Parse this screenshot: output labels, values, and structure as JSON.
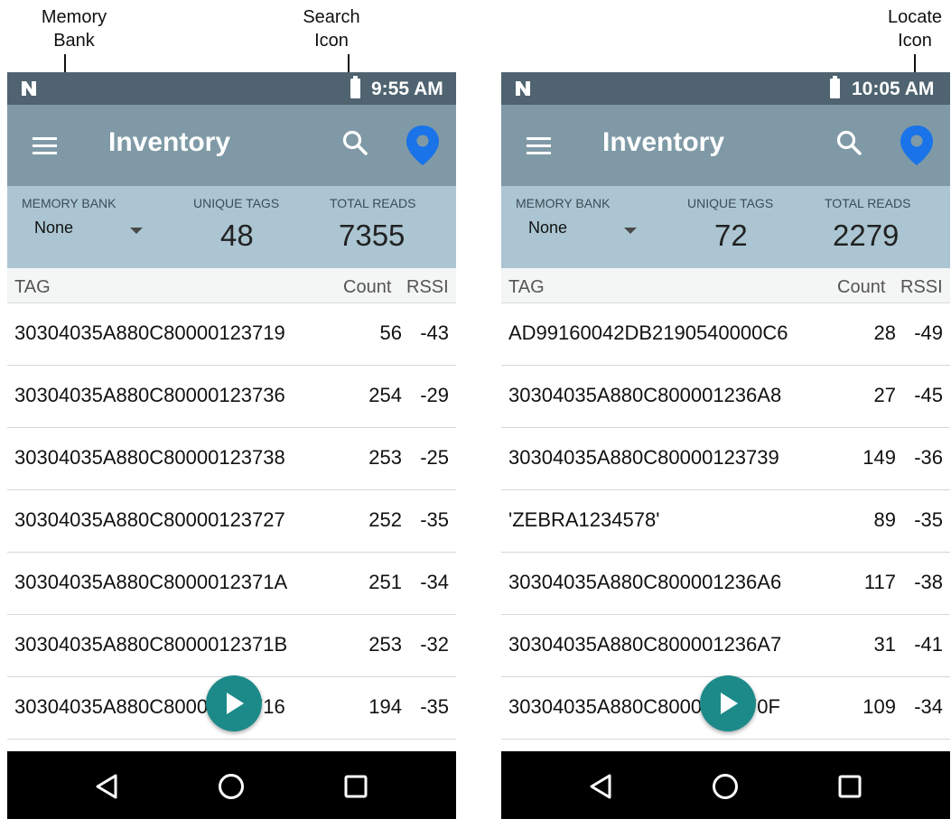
{
  "callouts": {
    "memory_bank": "Memory\nBank",
    "search_icon": "Search\nIcon",
    "locate_icon": "Locate\nIcon"
  },
  "screens": [
    {
      "status_time": "9:55 AM",
      "title": "Inventory",
      "stats": {
        "memory_bank_label": "MEMORY BANK",
        "memory_bank_value": "None",
        "unique_tags_label": "UNIQUE TAGS",
        "unique_tags_value": "48",
        "total_reads_label": "TOTAL READS",
        "total_reads_value": "7355"
      },
      "columns": {
        "tag": "TAG",
        "count": "Count",
        "rssi": "RSSI"
      },
      "rows": [
        {
          "tag": "30304035A880C80000123719",
          "count": "56",
          "rssi": "-43"
        },
        {
          "tag": "30304035A880C80000123736",
          "count": "254",
          "rssi": "-29"
        },
        {
          "tag": "30304035A880C80000123738",
          "count": "253",
          "rssi": "-25"
        },
        {
          "tag": "30304035A880C80000123727",
          "count": "252",
          "rssi": "-35"
        },
        {
          "tag": "30304035A880C8000012371A",
          "count": "251",
          "rssi": "-34"
        },
        {
          "tag": "30304035A880C8000012371B",
          "count": "253",
          "rssi": "-32"
        },
        {
          "tag": "30304035A880C80000123716",
          "count": "194",
          "rssi": "-35"
        }
      ]
    },
    {
      "status_time": "10:05 AM",
      "title": "Inventory",
      "stats": {
        "memory_bank_label": "MEMORY BANK",
        "memory_bank_value": "None",
        "unique_tags_label": "UNIQUE TAGS",
        "unique_tags_value": "72",
        "total_reads_label": "TOTAL READS",
        "total_reads_value": "2279"
      },
      "columns": {
        "tag": "TAG",
        "count": "Count",
        "rssi": "RSSI"
      },
      "rows": [
        {
          "tag": "AD99160042DB2190540000C6",
          "count": "28",
          "rssi": "-49"
        },
        {
          "tag": "30304035A880C800001236A8",
          "count": "27",
          "rssi": "-45"
        },
        {
          "tag": "30304035A880C80000123739",
          "count": "149",
          "rssi": "-36"
        },
        {
          "tag": "'ZEBRA1234578'",
          "count": "89",
          "rssi": "-35"
        },
        {
          "tag": "30304035A880C800001236A6",
          "count": "117",
          "rssi": "-38"
        },
        {
          "tag": "30304035A880C800001236A7",
          "count": "31",
          "rssi": "-41"
        },
        {
          "tag": "30304035A880C8000012370F",
          "count": "109",
          "rssi": "-34"
        }
      ]
    }
  ],
  "colors": {
    "status_bar": "#4f6370",
    "app_bar": "#7f9aa6",
    "stats_panel": "#abc6d2",
    "locate_icon": "#1a73e8",
    "fab": "#1d8a8a"
  },
  "icons": {
    "menu": "menu-icon",
    "search": "search-icon",
    "locate": "location-pin-icon",
    "play": "play-icon",
    "back": "back-triangle-icon",
    "home": "home-circle-icon",
    "recents": "recents-square-icon"
  }
}
